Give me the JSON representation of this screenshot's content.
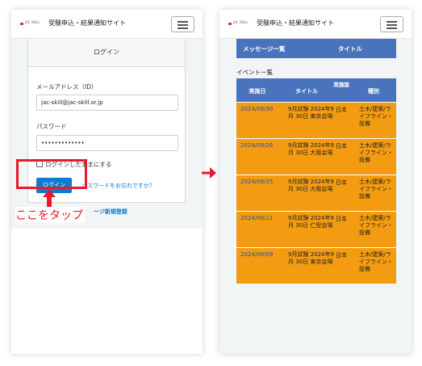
{
  "site": {
    "logo_text": "JAC SKILL",
    "title": "受験申込・結果通知サイト"
  },
  "login": {
    "card_title": "ログイン",
    "email_label": "メールアドレス（ID）",
    "email_value": "jac-skill@jac-skill.or.jp",
    "password_label": "パスワード",
    "password_value": "•••••••••••••",
    "remember_label": "ログインしたままにする",
    "login_button": "ログイン",
    "forgot_link": "パスワードをお忘れですか？",
    "register_link": "ージ新規登録"
  },
  "annotation": {
    "tap_here": "ここをタップ",
    "highlight_color": "#e8192c"
  },
  "messages": {
    "header_col1": "メッセージ一覧",
    "header_col2": "タイトル"
  },
  "events": {
    "section_title": "イベント一覧",
    "columns": {
      "date": "実施日",
      "title": "タイトル",
      "venue": "実施国",
      "type": "種別"
    },
    "rows": [
      {
        "date": "2024/09/30",
        "title": "9月試験 2024年9月 30日 東京会場",
        "venue": "日本",
        "type": "土木/建築/ライフライン・設備"
      },
      {
        "date": "2024/09/26",
        "title": "9月試験 2024年9月 30日 大阪会場",
        "venue": "日本",
        "type": "土木/建築/ライフライン・設備"
      },
      {
        "date": "2024/09/25",
        "title": "9月試験 2024年9月 30日 大阪会場",
        "venue": "日本",
        "type": "土木/建築/ライフライン・設備"
      },
      {
        "date": "2024/09/11",
        "title": "9月試験 2024年9月 30日 仁型会場",
        "venue": "日本",
        "type": "土木/建築/ライフライン・設備"
      },
      {
        "date": "2024/09/09",
        "title": "9月試験 2024年9月 30日 東京会場",
        "venue": "日本",
        "type": "土木/建築/ライフライン・設備"
      }
    ],
    "header_color": "#4a73bd",
    "row_color": "#f39c12"
  }
}
